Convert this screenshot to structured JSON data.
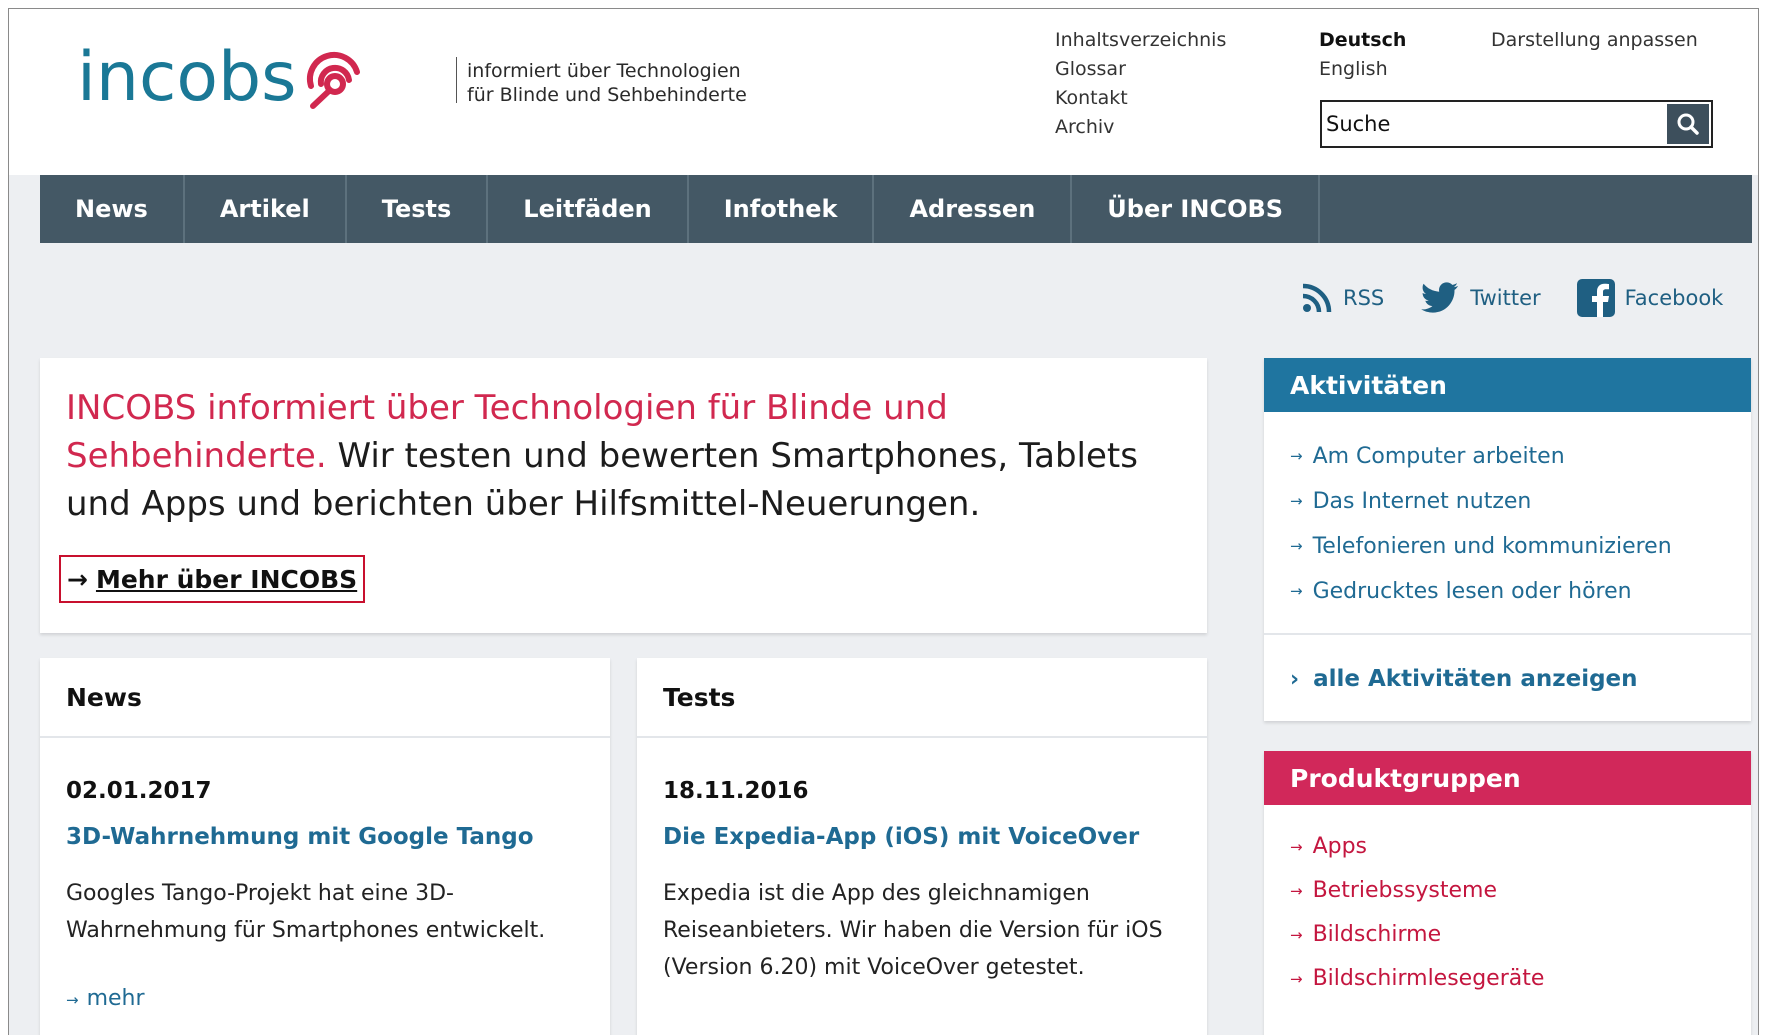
{
  "header": {
    "logo_text": "incobs",
    "tagline_line1": "informiert über Technologien",
    "tagline_line2": "für Blinde und Sehbehinderte",
    "meta_links": [
      "Inhaltsverzeichnis",
      "Glossar",
      "Kontakt",
      "Archiv"
    ],
    "languages": {
      "active": "Deutsch",
      "other": "English"
    },
    "display_settings": "Darstellung anpassen",
    "search": {
      "placeholder": "Suche",
      "icon": "search-icon"
    }
  },
  "nav": {
    "items": [
      "News",
      "Artikel",
      "Tests",
      "Leitfäden",
      "Infothek",
      "Adressen",
      "Über INCOBS"
    ]
  },
  "social": {
    "rss": "RSS",
    "twitter": "Twitter",
    "facebook": "Facebook"
  },
  "intro": {
    "highlight": "INCOBS informiert über Technologien für Blinde und Sehbehinderte.",
    "text": " Wir testen und bewerten Smartphones, Tablets und Apps und berichten über Hilfsmittel-Neuerungen.",
    "more_arrow": "→",
    "more_label": "Mehr über INCOBS"
  },
  "news": {
    "heading": "News",
    "date": "02.01.2017",
    "title": "3D-Wahrnehmung mit Google Tango",
    "body": "Googles Tango-Projekt hat eine 3D-Wahrnehmung für Smartphones entwickelt.",
    "more": "mehr"
  },
  "tests": {
    "heading": "Tests",
    "date": "18.11.2016",
    "title": "Die Expedia-App (iOS) mit VoiceOver",
    "body": "Expedia ist die App des gleichnamigen Reiseanbieters. Wir haben die Version für iOS (Version 6.20) mit VoiceOver getestet."
  },
  "activities": {
    "heading": "Aktivitäten",
    "items": [
      "Am Computer arbeiten",
      "Das Internet nutzen",
      "Telefonieren und kommunizieren",
      "Gedrucktes lesen oder hören"
    ],
    "all_label": "alle Aktivitäten anzeigen"
  },
  "products": {
    "heading": "Produktgruppen",
    "items": [
      "Apps",
      "Betriebssysteme",
      "Bildschirme",
      "Bildschirmlesegeräte"
    ]
  },
  "colors": {
    "brand_teal": "#1a7896",
    "accent_red": "#d1284f",
    "nav_bg": "#445865",
    "activities_head": "#1f75a0",
    "products_head": "#d1285a",
    "link_blue": "#1f6a93"
  }
}
